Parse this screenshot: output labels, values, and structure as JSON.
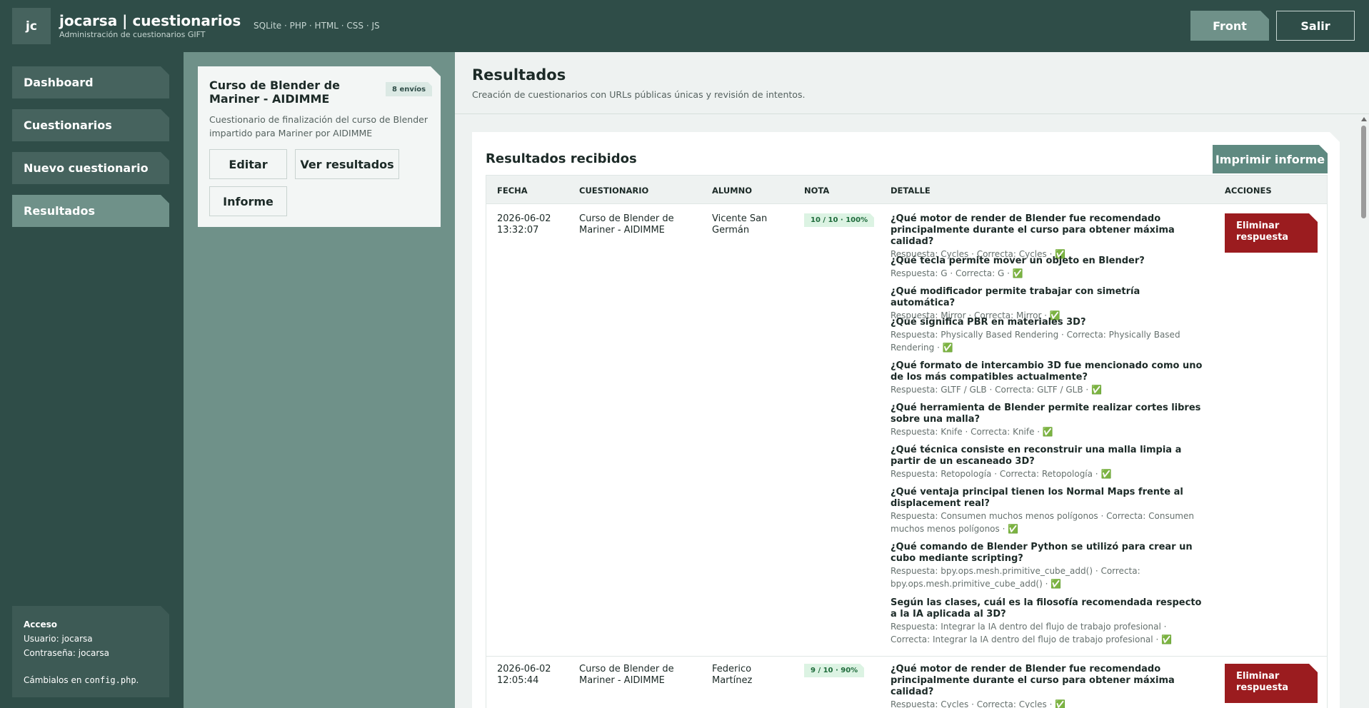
{
  "header": {
    "logo": "jc",
    "title": "jocarsa | cuestionarios",
    "subtitle": "Administración de cuestionarios GIFT",
    "tech": "SQLite · PHP · HTML · CSS · JS",
    "front_label": "Front",
    "salir_label": "Salir"
  },
  "sidebar": {
    "items": [
      {
        "label": "Dashboard"
      },
      {
        "label": "Cuestionarios"
      },
      {
        "label": "Nuevo cuestionario"
      },
      {
        "label": "Resultados"
      }
    ],
    "access": {
      "title": "Acceso",
      "user": "Usuario: jocarsa",
      "password": "Contraseña: jocarsa",
      "note_prefix": "Cámbialos en",
      "note_code": "config.php",
      "note_suffix": "."
    }
  },
  "quiz": {
    "title": "Curso de Blender de Mariner - AIDIMME",
    "badge": "8 envíos",
    "description": "Cuestionario de finalización del curso de Blender impartido para Mariner por AIDIMME",
    "edit_label": "Editar",
    "results_label": "Ver resultados",
    "report_label": "Informe"
  },
  "main": {
    "title": "Resultados",
    "subtitle": "Creación de cuestionarios con URLs públicas únicas y revisión de intentos.",
    "panel_title": "Resultados recibidos",
    "print_label": "Imprimir informe",
    "columns": [
      "FECHA",
      "CUESTIONARIO",
      "ALUMNO",
      "NOTA",
      "DETALLE",
      "ACCIONES"
    ],
    "rows": [
      {
        "date": "2026-06-02",
        "time": "13:32:07",
        "quiz": "Curso de Blender de Mariner - AIDIMME",
        "student": "Vicente San Germán",
        "grade": "10 / 10 · 100%",
        "delete_label": "Eliminar respuesta",
        "details": [
          {
            "q": "¿Qué motor de render de Blender fue recomendado principalmente durante el curso para obtener máxima calidad?",
            "r": "Respuesta: Cycles · Correcta: Cycles · ✅"
          },
          {
            "q": "¿Qué tecla permite mover un objeto en Blender?",
            "r": "Respuesta: G · Correcta: G · ✅"
          },
          {
            "q": "¿Qué modificador permite trabajar con simetría automática?",
            "r": "Respuesta: Mirror · Correcta: Mirror · ✅"
          },
          {
            "q": "¿Qué significa PBR en materiales 3D?",
            "r": "Respuesta: Physically Based Rendering · Correcta: Physically Based Rendering · ✅"
          },
          {
            "q": "¿Qué formato de intercambio 3D fue mencionado como uno de los más compatibles actualmente?",
            "r": "Respuesta: GLTF / GLB · Correcta: GLTF / GLB · ✅"
          },
          {
            "q": "¿Qué herramienta de Blender permite realizar cortes libres sobre una malla?",
            "r": "Respuesta: Knife · Correcta: Knife · ✅"
          },
          {
            "q": "¿Qué técnica consiste en reconstruir una malla limpia a partir de un escaneado 3D?",
            "r": "Respuesta: Retopología · Correcta: Retopología · ✅"
          },
          {
            "q": "¿Qué ventaja principal tienen los Normal Maps frente al displacement real?",
            "r": "Respuesta: Consumen muchos menos polígonos · Correcta: Consumen muchos menos polígonos · ✅"
          },
          {
            "q": "¿Qué comando de Blender Python se utilizó para crear un cubo mediante scripting?",
            "r": "Respuesta: bpy.ops.mesh.primitive_cube_add() · Correcta: bpy.ops.mesh.primitive_cube_add() · ✅"
          },
          {
            "q": "Según las clases, cuál es la filosofía recomendada respecto a la IA aplicada al 3D?",
            "r": "Respuesta: Integrar la IA dentro del flujo de trabajo profesional · Correcta: Integrar la IA dentro del flujo de trabajo profesional · ✅"
          }
        ]
      },
      {
        "date": "2026-06-02",
        "time": "12:05:44",
        "quiz": "Curso de Blender de Mariner - AIDIMME",
        "student": "Federico Martínez",
        "grade": "9 / 10 · 90%",
        "delete_label": "Eliminar respuesta",
        "details": [
          {
            "q": "¿Qué motor de render de Blender fue recomendado principalmente durante el curso para obtener máxima calidad?",
            "r": "Respuesta: Cycles · Correcta: Cycles · ✅"
          }
        ]
      }
    ]
  }
}
